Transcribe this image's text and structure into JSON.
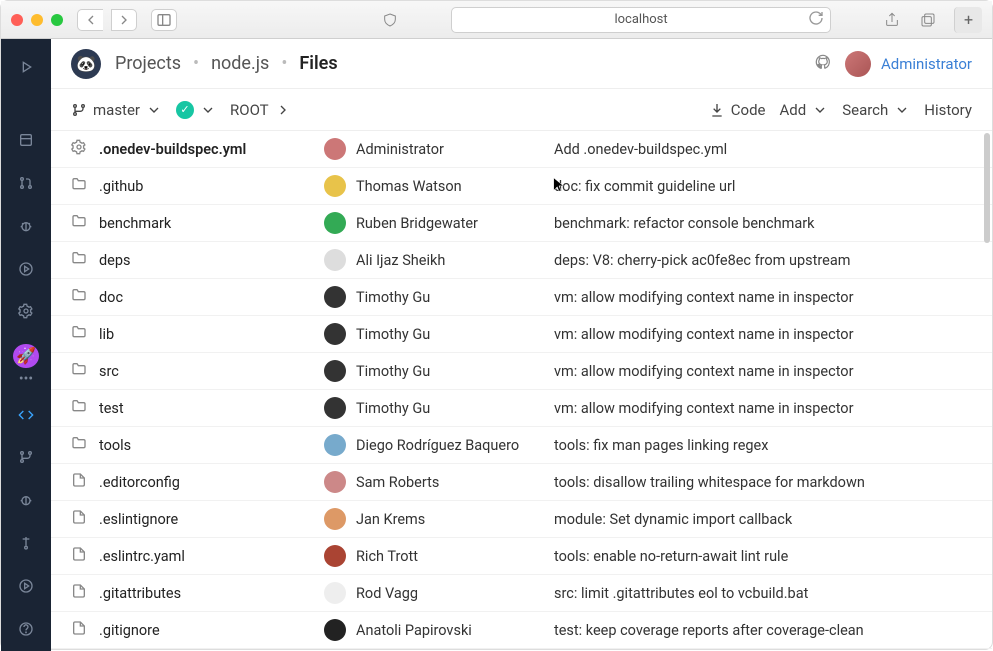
{
  "browser": {
    "url": "localhost"
  },
  "header": {
    "crumbs": [
      "Projects",
      "node.js",
      "Files"
    ],
    "user": "Administrator"
  },
  "toolbar": {
    "branch": "master",
    "root": "ROOT",
    "code": "Code",
    "add": "Add",
    "search": "Search",
    "history": "History"
  },
  "files": [
    {
      "icon": "gear",
      "name": ".onedev-buildspec.yml",
      "author": "Administrator",
      "msg": "Add .onedev-buildspec.yml",
      "av": "#c77"
    },
    {
      "icon": "folder",
      "name": ".github",
      "author": "Thomas Watson",
      "msg": "doc: fix commit guideline url",
      "av": "#e8c34a"
    },
    {
      "icon": "folder",
      "name": "benchmark",
      "author": "Ruben Bridgewater",
      "msg": "benchmark: refactor console benchmark",
      "av": "#3a5"
    },
    {
      "icon": "folder",
      "name": "deps",
      "author": "Ali Ijaz Sheikh",
      "msg": "deps: V8: cherry-pick ac0fe8ec from upstream",
      "av": "#ddd"
    },
    {
      "icon": "folder",
      "name": "doc",
      "author": "Timothy Gu",
      "msg": "vm: allow modifying context name in inspector",
      "av": "#333"
    },
    {
      "icon": "folder",
      "name": "lib",
      "author": "Timothy Gu",
      "msg": "vm: allow modifying context name in inspector",
      "av": "#333"
    },
    {
      "icon": "folder",
      "name": "src",
      "author": "Timothy Gu",
      "msg": "vm: allow modifying context name in inspector",
      "av": "#333"
    },
    {
      "icon": "folder",
      "name": "test",
      "author": "Timothy Gu",
      "msg": "vm: allow modifying context name in inspector",
      "av": "#333"
    },
    {
      "icon": "folder",
      "name": "tools",
      "author": "Diego Rodríguez Baquero",
      "msg": "tools: fix man pages linking regex",
      "av": "#7ac"
    },
    {
      "icon": "file",
      "name": ".editorconfig",
      "author": "Sam Roberts",
      "msg": "tools: disallow trailing whitespace for markdown",
      "av": "#c88"
    },
    {
      "icon": "file",
      "name": ".eslintignore",
      "author": "Jan Krems",
      "msg": "module: Set dynamic import callback",
      "av": "#d96"
    },
    {
      "icon": "file",
      "name": ".eslintrc.yaml",
      "author": "Rich Trott",
      "msg": "tools: enable no-return-await lint rule",
      "av": "#a43"
    },
    {
      "icon": "file",
      "name": ".gitattributes",
      "author": "Rod Vagg",
      "msg": "src: limit .gitattributes eol to vcbuild.bat",
      "av": "#eee"
    },
    {
      "icon": "file",
      "name": ".gitignore",
      "author": "Anatoli Papirovski",
      "msg": "test: keep coverage reports after coverage-clean",
      "av": "#222"
    }
  ]
}
